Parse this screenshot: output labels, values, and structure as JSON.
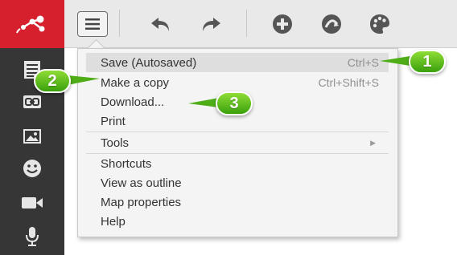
{
  "toolbar": {
    "buttons": [
      {
        "name": "main-menu",
        "icon": "hamburger-icon"
      },
      {
        "name": "undo",
        "icon": "undo-arrow-icon"
      },
      {
        "name": "redo",
        "icon": "redo-arrow-icon"
      },
      {
        "name": "add",
        "icon": "plus-circle-icon"
      },
      {
        "name": "link",
        "icon": "curved-link-icon"
      },
      {
        "name": "style",
        "icon": "palette-icon"
      }
    ]
  },
  "sidebar": {
    "items": [
      {
        "icon": "note-icon"
      },
      {
        "icon": "link-icon"
      },
      {
        "icon": "image-icon"
      },
      {
        "icon": "smiley-icon"
      },
      {
        "icon": "video-icon"
      },
      {
        "icon": "microphone-icon"
      }
    ]
  },
  "menu": {
    "items": [
      {
        "label": "Save (Autosaved)",
        "shortcut": "Ctrl+S"
      },
      {
        "label": "Make a copy",
        "shortcut": "Ctrl+Shift+S"
      },
      {
        "label": "Download...",
        "shortcut": ""
      },
      {
        "label": "Print",
        "shortcut": ""
      },
      {
        "label": "Tools",
        "shortcut": ""
      },
      {
        "label": "Shortcuts",
        "shortcut": ""
      },
      {
        "label": "View as outline",
        "shortcut": ""
      },
      {
        "label": "Map properties",
        "shortcut": ""
      },
      {
        "label": "Help",
        "shortcut": ""
      }
    ]
  },
  "callouts": [
    "1",
    "2",
    "3"
  ],
  "colors": {
    "brand_red": "#d6202e",
    "sidebar_bg": "#363636",
    "toolbar_bg": "#e9e9e9",
    "callout_green": "#5cbf1f"
  }
}
